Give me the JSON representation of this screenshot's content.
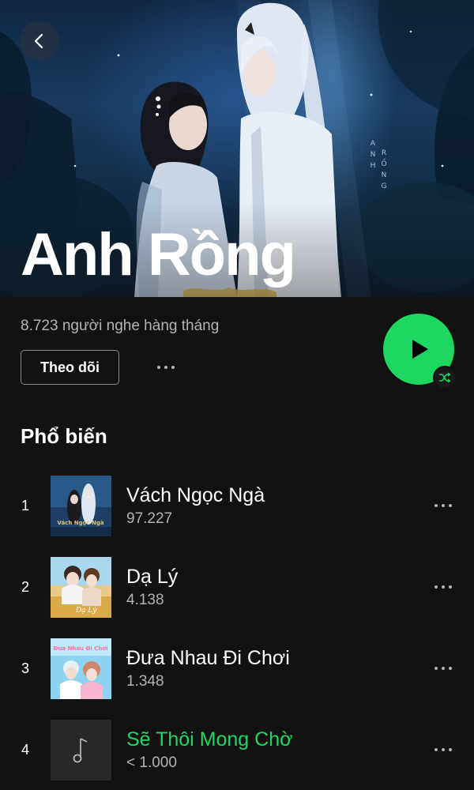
{
  "artist": {
    "name": "Anh Rồng",
    "monthly_listeners": "8.723 người nghe hàng tháng",
    "follow_label": "Theo dõi"
  },
  "hero": {
    "watermark_letters": [
      "A",
      "N",
      "H",
      "R",
      "Ồ",
      "N",
      "G"
    ]
  },
  "icons": {
    "back": "chevron-left-icon",
    "more": "more-horizontal-icon",
    "play": "play-icon",
    "shuffle": "shuffle-icon",
    "music_note": "music-note-icon"
  },
  "popular": {
    "title": "Phổ biến",
    "tracks": [
      {
        "number": "1",
        "title": "Vách Ngọc Ngà",
        "plays": "97.227",
        "cover_text": "Vách Ngọc Ngà",
        "active": false
      },
      {
        "number": "2",
        "title": "Dạ Lý",
        "plays": "4.138",
        "cover_text": "Dạ Lý",
        "active": false
      },
      {
        "number": "3",
        "title": "Đưa Nhau Đi Chơi",
        "plays": "1.348",
        "cover_text": "Đưa Nhau Đi Chơi",
        "active": false
      },
      {
        "number": "4",
        "title": "Sẽ Thôi Mong Chờ",
        "plays": "< 1.000",
        "active": true
      }
    ]
  },
  "colors": {
    "background": "#121212",
    "accent": "#1ed760",
    "secondary_text": "#b3b3b3"
  }
}
